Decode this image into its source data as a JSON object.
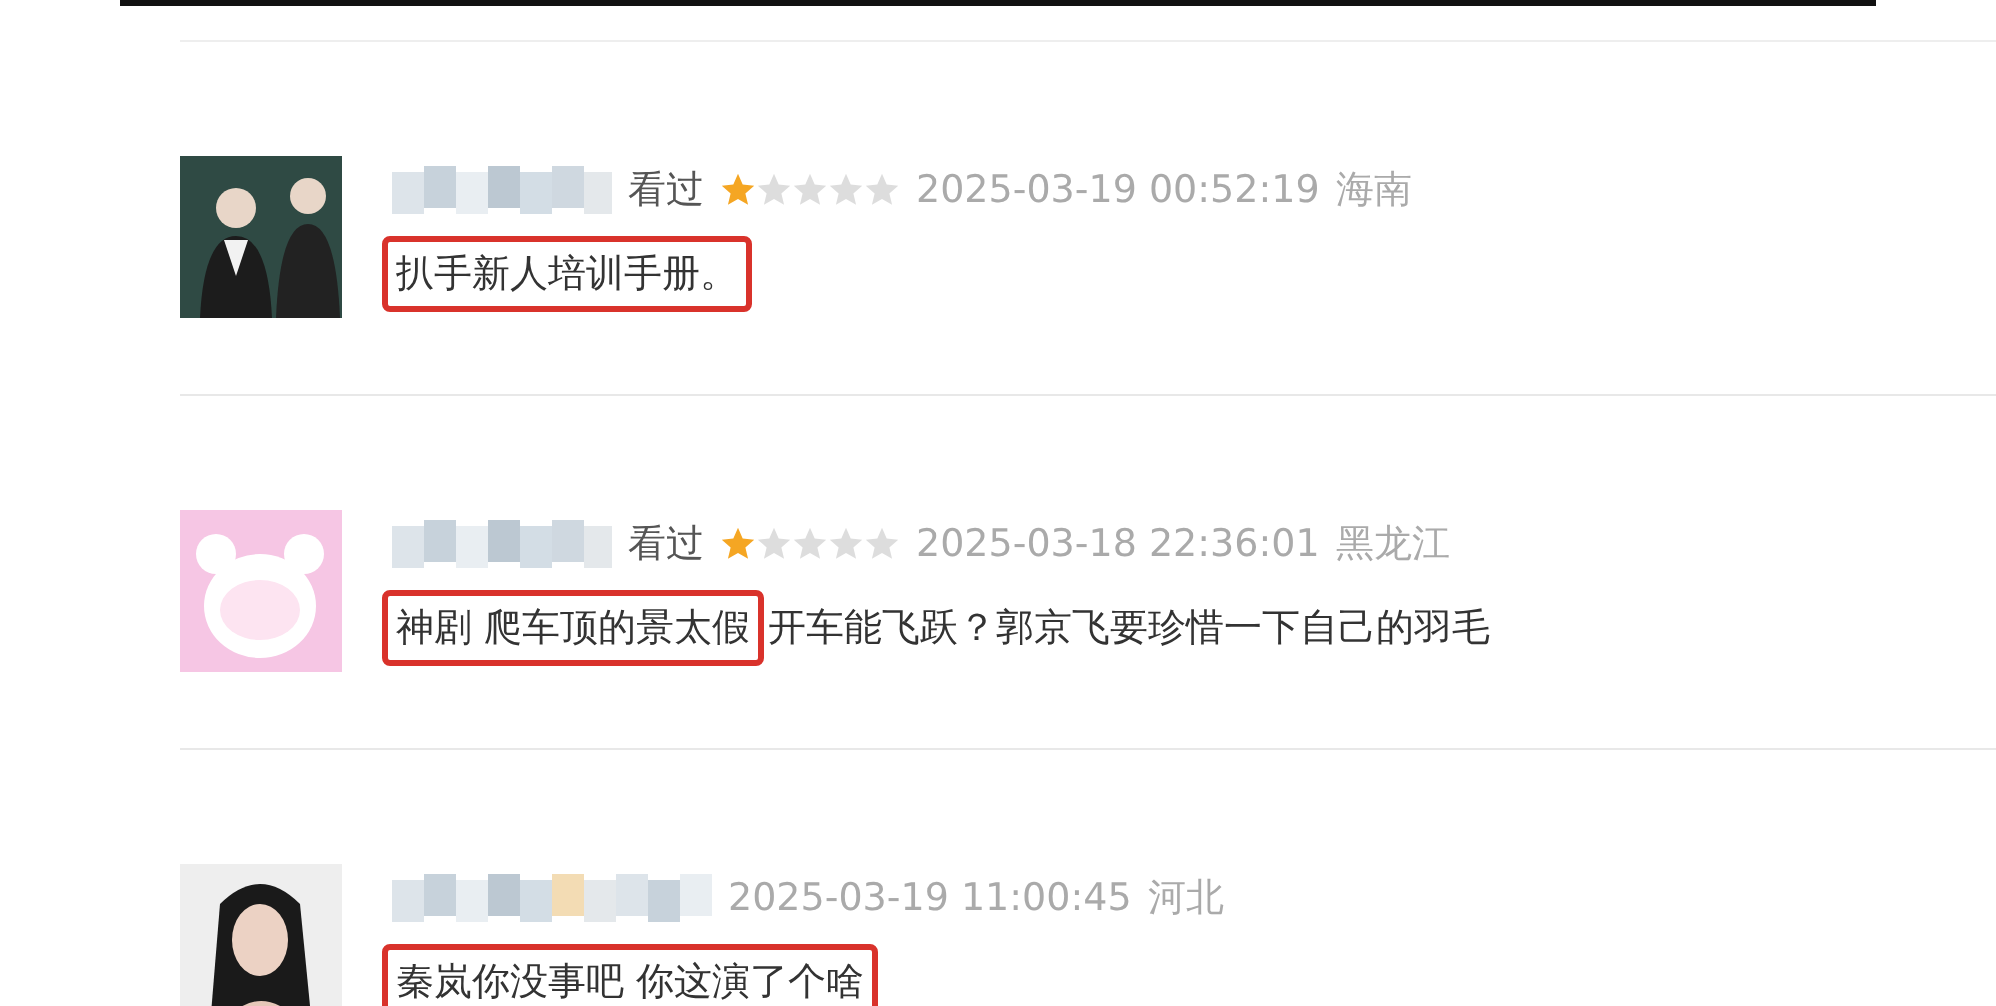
{
  "reviews": [
    {
      "status": "看过",
      "stars": 1,
      "time": "2025-03-19 00:52:19",
      "location": "海南",
      "highlight": "扒手新人培训手册。"
    },
    {
      "status": "看过",
      "stars": 1,
      "time": "2025-03-18 22:36:01",
      "location": "黑龙江",
      "highlight": "神剧 爬车顶的景太假",
      "comment": "开车能飞跃？郭京飞要珍惜一下自己的羽毛"
    },
    {
      "time": "2025-03-19 11:00:45",
      "location": "河北",
      "highlight": "秦岚你没事吧 你这演了个啥"
    }
  ]
}
